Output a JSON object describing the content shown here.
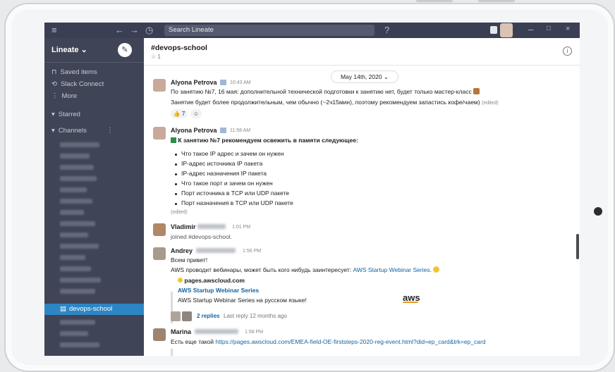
{
  "topbar": {
    "search_placeholder": "Search Lineate"
  },
  "sidebar": {
    "workspace": "Lineate ⌄",
    "saved_items": "Saved items",
    "slack_connect": "Slack Connect",
    "more": "More",
    "starred": "Starred",
    "channels": "Channels",
    "active_channel": "devops-school"
  },
  "channel": {
    "title": "#devops-school",
    "subtitle": "☆ 1"
  },
  "date_divider": "May 14th, 2020 ⌄",
  "messages": [
    {
      "author": "Alyona Petrova",
      "time": "10:43 AM",
      "line1": "По занятию №7, 16 мая: дополнительной технической подготовки к занятию нет, будет только мастер-класс",
      "line2": "Занятие будет более продолжительным, чем обычно (~2ч15мин), поэтому рекомендуем запастись кофе/чаем)",
      "edited": "(edited)",
      "reaction_count": "7"
    },
    {
      "author": "Alyona Petrova",
      "time": "11:58 AM",
      "intro": "К занятию №7 рекомендуем освежить в памяти следующее:",
      "bullets": [
        "Что такое IP адрес и зачем он нужен",
        "IP-адрес источника IP пакета",
        "IP-адрес назначения IP пакета",
        "Что такое порт и зачем он нужен",
        "Порт источника в TCP или UDP пакете",
        "Порт назначения в TCP или UDP пакете"
      ],
      "edited": "(edited)"
    },
    {
      "author": "Vladimir",
      "time": "1:01 PM",
      "text": "joined #devops-school."
    },
    {
      "author": "Andrey",
      "time": "1:56 PM",
      "line1": "Всем привет!",
      "line2_prefix": "AWS проводит вебинары, может быть кого нибудь заинтересует: ",
      "line2_link": "AWS Startup Webinar Series.",
      "preview_site": "pages.awscloud.com",
      "preview_title": "AWS Startup Webinar Series",
      "preview_desc": "AWS Startup Webinar Series на русском языке!",
      "preview_logo": "aws",
      "replies": "2 replies",
      "last_reply": "Last reply 12 months ago"
    },
    {
      "author": "Marina",
      "time": "1:58 PM",
      "prefix": "Есть еще такой ",
      "link": "https://pages.awscloud.com/EMEA-field-OE-firststeps-2020-reg-event.html?did=ep_card&trk=ep_card"
    }
  ],
  "colors": {
    "sidebar_bg": "#3f4556",
    "topbar_bg": "#3b3f54",
    "active_channel": "#2d86c4",
    "link": "#1264a3"
  }
}
